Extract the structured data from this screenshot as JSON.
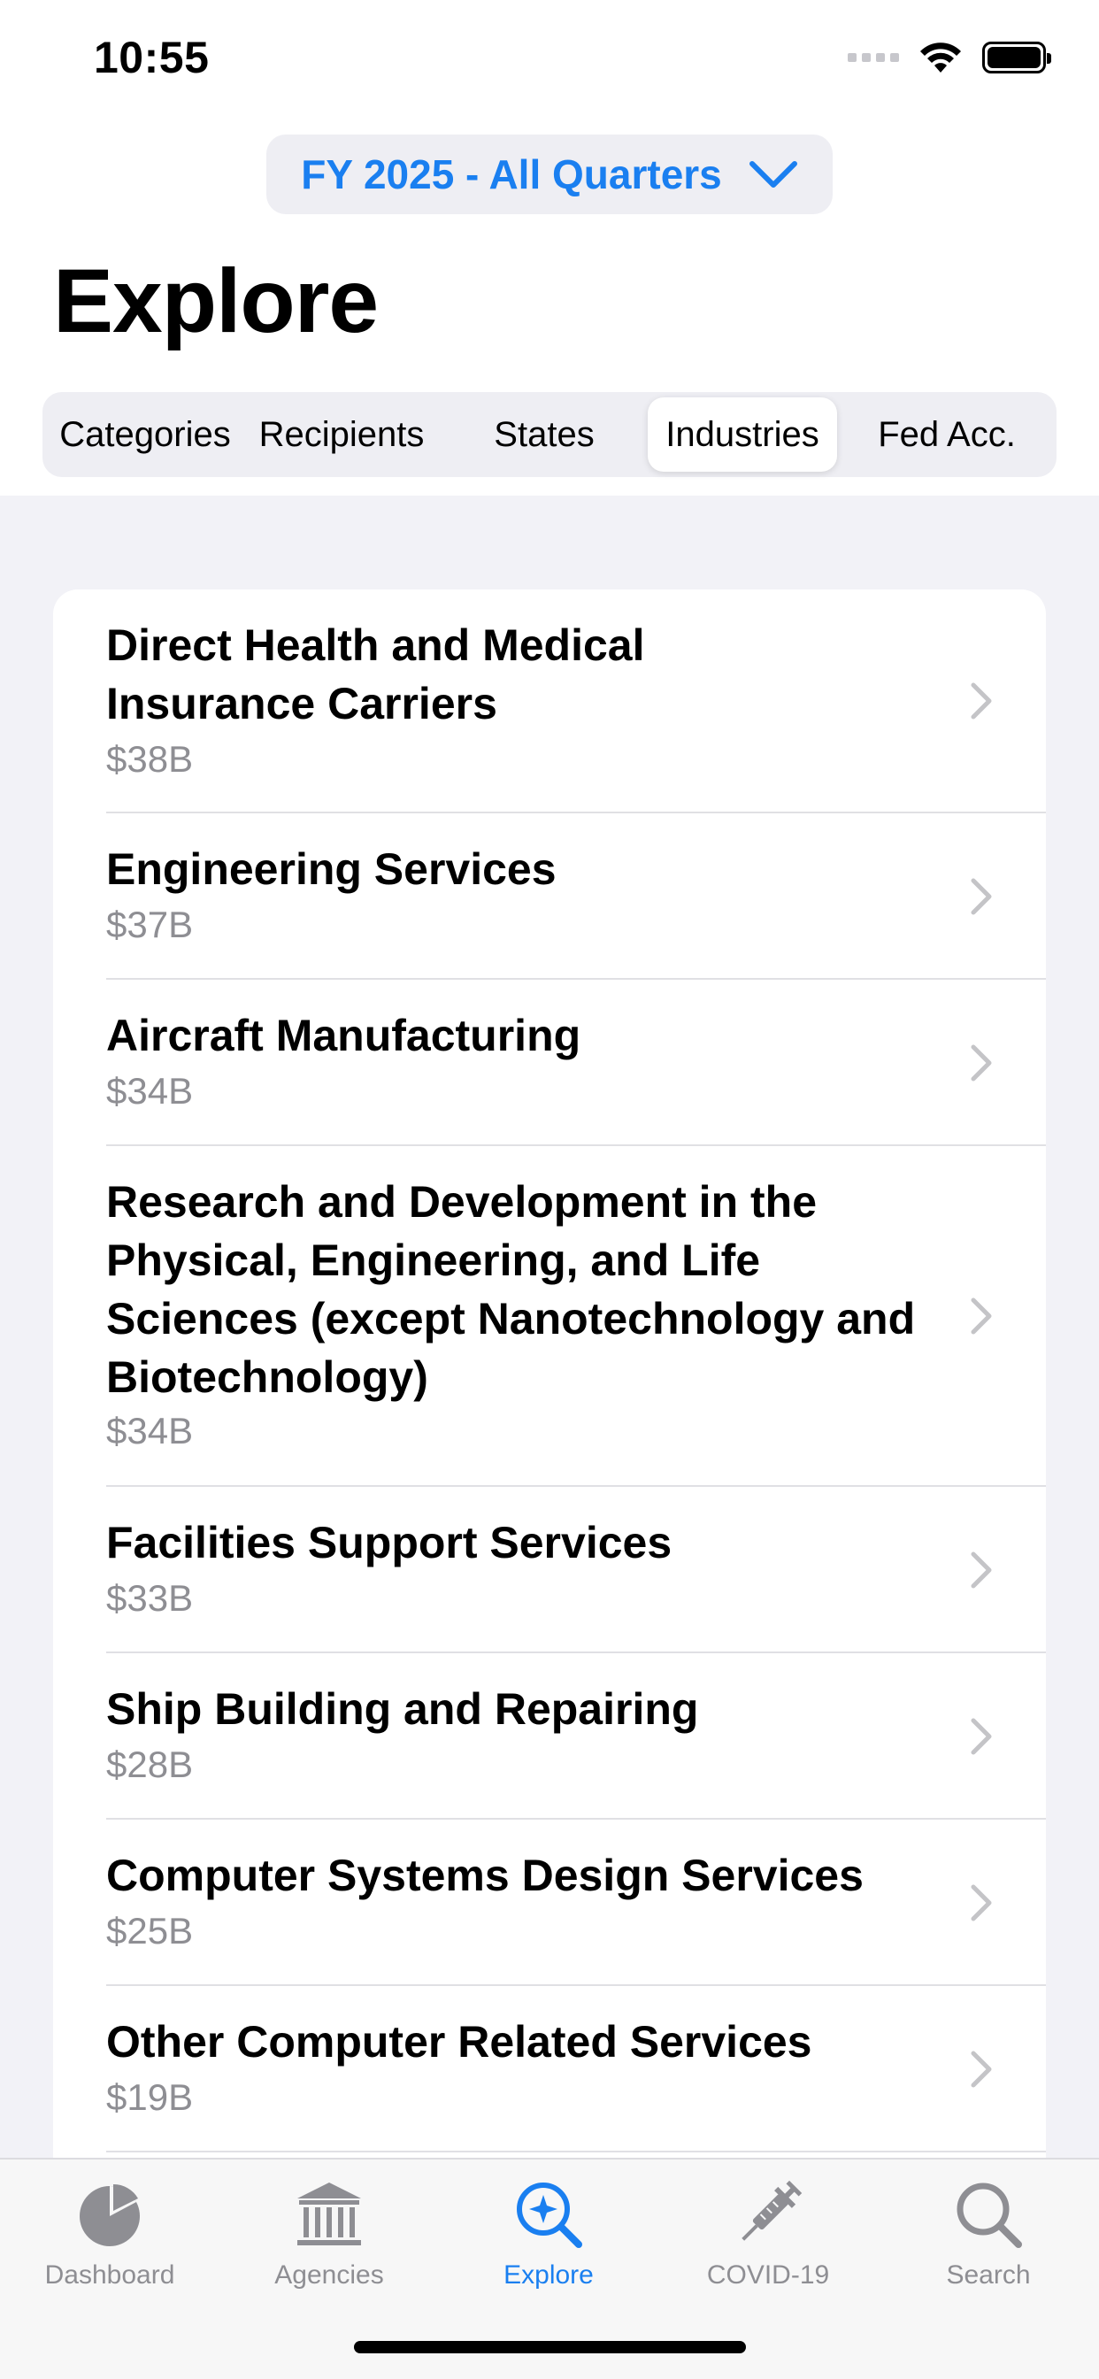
{
  "status": {
    "time": "10:55"
  },
  "period_selector": {
    "label": "FY 2025 - All Quarters"
  },
  "page": {
    "title": "Explore"
  },
  "segments": [
    {
      "label": "Categories"
    },
    {
      "label": "Recipients"
    },
    {
      "label": "States"
    },
    {
      "label": "Industries",
      "selected": true
    },
    {
      "label": "Fed Acc."
    }
  ],
  "industries": [
    {
      "name": "Direct Health and Medical Insurance Carriers",
      "amount": "$38B"
    },
    {
      "name": "Engineering Services",
      "amount": "$37B"
    },
    {
      "name": "Aircraft Manufacturing",
      "amount": "$34B"
    },
    {
      "name": "Research and Development in the Physical, Engineering, and Life Sciences (except Nanotechnology and Biotechnology)",
      "amount": "$34B"
    },
    {
      "name": "Facilities Support Services",
      "amount": "$33B"
    },
    {
      "name": "Ship Building and Repairing",
      "amount": "$28B"
    },
    {
      "name": "Computer Systems Design Services",
      "amount": "$25B"
    },
    {
      "name": "Other Computer Related Services",
      "amount": "$19B"
    }
  ],
  "tabbar": {
    "tabs": [
      {
        "label": "Dashboard",
        "icon": "pie-chart-icon"
      },
      {
        "label": "Agencies",
        "icon": "building-columns-icon"
      },
      {
        "label": "Explore",
        "icon": "magnifier-sparkle-icon",
        "active": true
      },
      {
        "label": "COVID-19",
        "icon": "syringe-icon"
      },
      {
        "label": "Search",
        "icon": "search-icon"
      }
    ]
  },
  "colors": {
    "accent": "#1a7ff0",
    "secondary_text": "#8e8e93",
    "background": "#f2f2f7"
  }
}
